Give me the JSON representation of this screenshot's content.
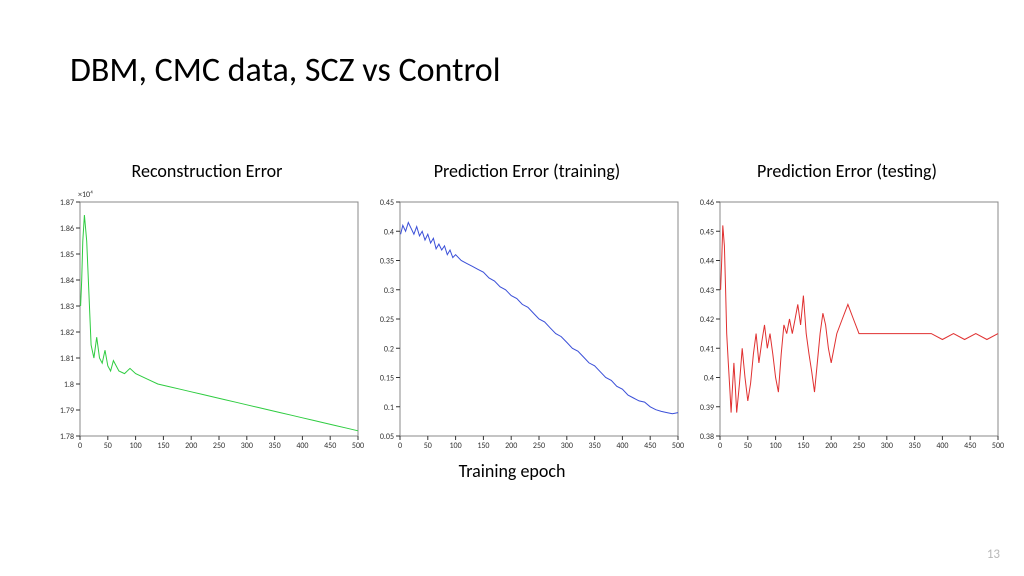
{
  "slide": {
    "title": "DBM, CMC data, SCZ vs Control",
    "xlabel": "Training epoch",
    "page_number": "13"
  },
  "chart_data": [
    {
      "type": "line",
      "title": "Reconstruction Error",
      "color": "#2ecc40",
      "xlabel": "",
      "ylabel": "",
      "xlim": [
        0,
        500
      ],
      "ylim": [
        1.78,
        1.87
      ],
      "y_exponent_label": "×10⁴",
      "xticks": [
        0,
        50,
        100,
        150,
        200,
        250,
        300,
        350,
        400,
        450,
        500
      ],
      "yticks": [
        1.78,
        1.79,
        1.8,
        1.81,
        1.82,
        1.83,
        1.84,
        1.85,
        1.86,
        1.87
      ],
      "ytick_labels": [
        "1.78",
        "1.79",
        "1.8",
        "1.81",
        "1.82",
        "1.83",
        "1.84",
        "1.85",
        "1.86",
        "1.87"
      ],
      "x": [
        1,
        3,
        5,
        8,
        12,
        16,
        20,
        25,
        30,
        35,
        40,
        45,
        50,
        55,
        60,
        70,
        80,
        90,
        100,
        120,
        140,
        160,
        180,
        200,
        220,
        240,
        260,
        280,
        300,
        320,
        340,
        360,
        380,
        400,
        420,
        440,
        460,
        480,
        500
      ],
      "y": [
        1.83,
        1.84,
        1.855,
        1.865,
        1.855,
        1.835,
        1.815,
        1.81,
        1.818,
        1.81,
        1.808,
        1.813,
        1.807,
        1.805,
        1.809,
        1.805,
        1.804,
        1.806,
        1.804,
        1.802,
        1.8,
        1.799,
        1.798,
        1.797,
        1.796,
        1.795,
        1.794,
        1.793,
        1.792,
        1.791,
        1.79,
        1.789,
        1.788,
        1.787,
        1.786,
        1.785,
        1.784,
        1.783,
        1.782
      ]
    },
    {
      "type": "line",
      "title": "Prediction Error (training)",
      "color": "#3a4fd8",
      "xlabel": "",
      "ylabel": "",
      "xlim": [
        0,
        500
      ],
      "ylim": [
        0.05,
        0.45
      ],
      "xticks": [
        0,
        50,
        100,
        150,
        200,
        250,
        300,
        350,
        400,
        450,
        500
      ],
      "yticks": [
        0.05,
        0.1,
        0.15,
        0.2,
        0.25,
        0.3,
        0.35,
        0.4,
        0.45
      ],
      "ytick_labels": [
        "0.05",
        "0.1",
        "0.15",
        "0.2",
        "0.25",
        "0.3",
        "0.35",
        "0.4",
        "0.45"
      ],
      "x": [
        1,
        5,
        10,
        15,
        20,
        25,
        30,
        35,
        40,
        45,
        50,
        55,
        60,
        65,
        70,
        75,
        80,
        85,
        90,
        95,
        100,
        110,
        120,
        130,
        140,
        150,
        160,
        170,
        180,
        190,
        200,
        210,
        220,
        230,
        240,
        250,
        260,
        270,
        280,
        290,
        300,
        310,
        320,
        330,
        340,
        350,
        360,
        370,
        380,
        390,
        400,
        410,
        420,
        430,
        440,
        450,
        460,
        470,
        480,
        490,
        500
      ],
      "y": [
        0.395,
        0.41,
        0.4,
        0.415,
        0.405,
        0.395,
        0.408,
        0.392,
        0.4,
        0.385,
        0.395,
        0.38,
        0.388,
        0.37,
        0.378,
        0.368,
        0.375,
        0.36,
        0.368,
        0.355,
        0.36,
        0.35,
        0.345,
        0.34,
        0.335,
        0.33,
        0.32,
        0.315,
        0.305,
        0.3,
        0.29,
        0.285,
        0.275,
        0.27,
        0.26,
        0.25,
        0.245,
        0.235,
        0.225,
        0.22,
        0.21,
        0.2,
        0.195,
        0.185,
        0.175,
        0.17,
        0.16,
        0.15,
        0.145,
        0.135,
        0.13,
        0.12,
        0.115,
        0.11,
        0.108,
        0.1,
        0.095,
        0.092,
        0.09,
        0.088,
        0.09
      ]
    },
    {
      "type": "line",
      "title": "Prediction Error (testing)",
      "color": "#e03030",
      "xlabel": "",
      "ylabel": "",
      "xlim": [
        0,
        500
      ],
      "ylim": [
        0.38,
        0.46
      ],
      "xticks": [
        0,
        50,
        100,
        150,
        200,
        250,
        300,
        350,
        400,
        450,
        500
      ],
      "yticks": [
        0.38,
        0.39,
        0.4,
        0.41,
        0.42,
        0.43,
        0.44,
        0.45,
        0.46
      ],
      "ytick_labels": [
        "0.38",
        "0.39",
        "0.4",
        "0.41",
        "0.42",
        "0.43",
        "0.44",
        "0.45",
        "0.46"
      ],
      "x": [
        1,
        3,
        5,
        8,
        10,
        12,
        15,
        18,
        20,
        22,
        25,
        28,
        30,
        35,
        40,
        45,
        50,
        55,
        60,
        65,
        70,
        75,
        80,
        85,
        90,
        95,
        100,
        105,
        110,
        115,
        120,
        125,
        130,
        135,
        140,
        145,
        150,
        155,
        160,
        165,
        170,
        175,
        180,
        185,
        190,
        195,
        200,
        210,
        220,
        230,
        240,
        250,
        260,
        280,
        300,
        320,
        340,
        360,
        380,
        400,
        420,
        440,
        460,
        480,
        500
      ],
      "y": [
        0.43,
        0.44,
        0.452,
        0.445,
        0.43,
        0.415,
        0.405,
        0.395,
        0.388,
        0.395,
        0.405,
        0.395,
        0.388,
        0.398,
        0.41,
        0.4,
        0.392,
        0.398,
        0.408,
        0.415,
        0.405,
        0.412,
        0.418,
        0.41,
        0.415,
        0.408,
        0.4,
        0.395,
        0.408,
        0.418,
        0.415,
        0.42,
        0.415,
        0.42,
        0.425,
        0.418,
        0.428,
        0.415,
        0.408,
        0.402,
        0.395,
        0.405,
        0.415,
        0.422,
        0.418,
        0.41,
        0.405,
        0.415,
        0.42,
        0.425,
        0.42,
        0.415,
        0.415,
        0.415,
        0.415,
        0.415,
        0.415,
        0.415,
        0.415,
        0.413,
        0.415,
        0.413,
        0.415,
        0.413,
        0.415
      ]
    }
  ]
}
